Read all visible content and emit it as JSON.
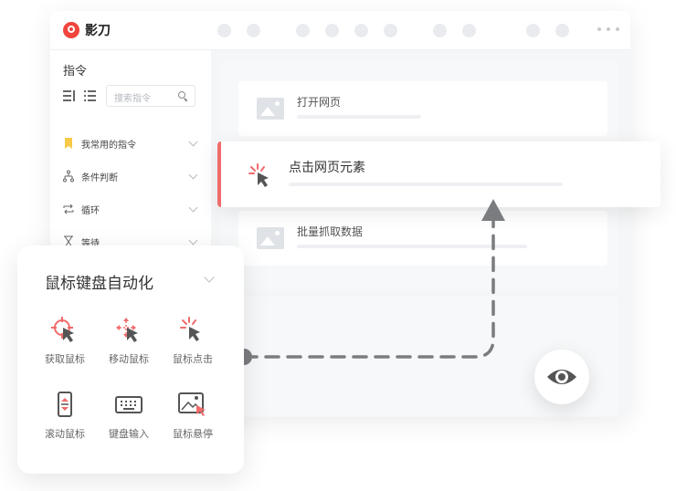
{
  "app": {
    "name": "影刀"
  },
  "sidebar": {
    "title": "指令",
    "search_placeholder": "搜索指令",
    "categories": [
      {
        "label": "我常用的指令",
        "icon": "bookmark-icon"
      },
      {
        "label": "条件判断",
        "icon": "branch-icon"
      },
      {
        "label": "循环",
        "icon": "loop-icon"
      },
      {
        "label": "等待",
        "icon": "hourglass-icon"
      }
    ]
  },
  "flow": {
    "steps": [
      {
        "title": "打开网页",
        "icon": "image-icon"
      },
      {
        "title": "点击网页元素",
        "icon": "click-icon",
        "active": true
      },
      {
        "title": "批量抓取数据",
        "icon": "image-icon"
      }
    ]
  },
  "panel": {
    "title": "鼠标键盘自动化",
    "tools": [
      {
        "label": "获取鼠标",
        "icon": "crosshair-cursor-icon"
      },
      {
        "label": "移动鼠标",
        "icon": "move-cursor-icon"
      },
      {
        "label": "鼠标点击",
        "icon": "click-cursor-icon"
      },
      {
        "label": "滚动鼠标",
        "icon": "scroll-mouse-icon"
      },
      {
        "label": "键盘输入",
        "icon": "keyboard-icon"
      },
      {
        "label": "鼠标悬停",
        "icon": "hover-image-icon"
      }
    ]
  },
  "colors": {
    "accent": "#f06b6b",
    "arrow": "#7a7c80",
    "brand": "#f0453d"
  }
}
